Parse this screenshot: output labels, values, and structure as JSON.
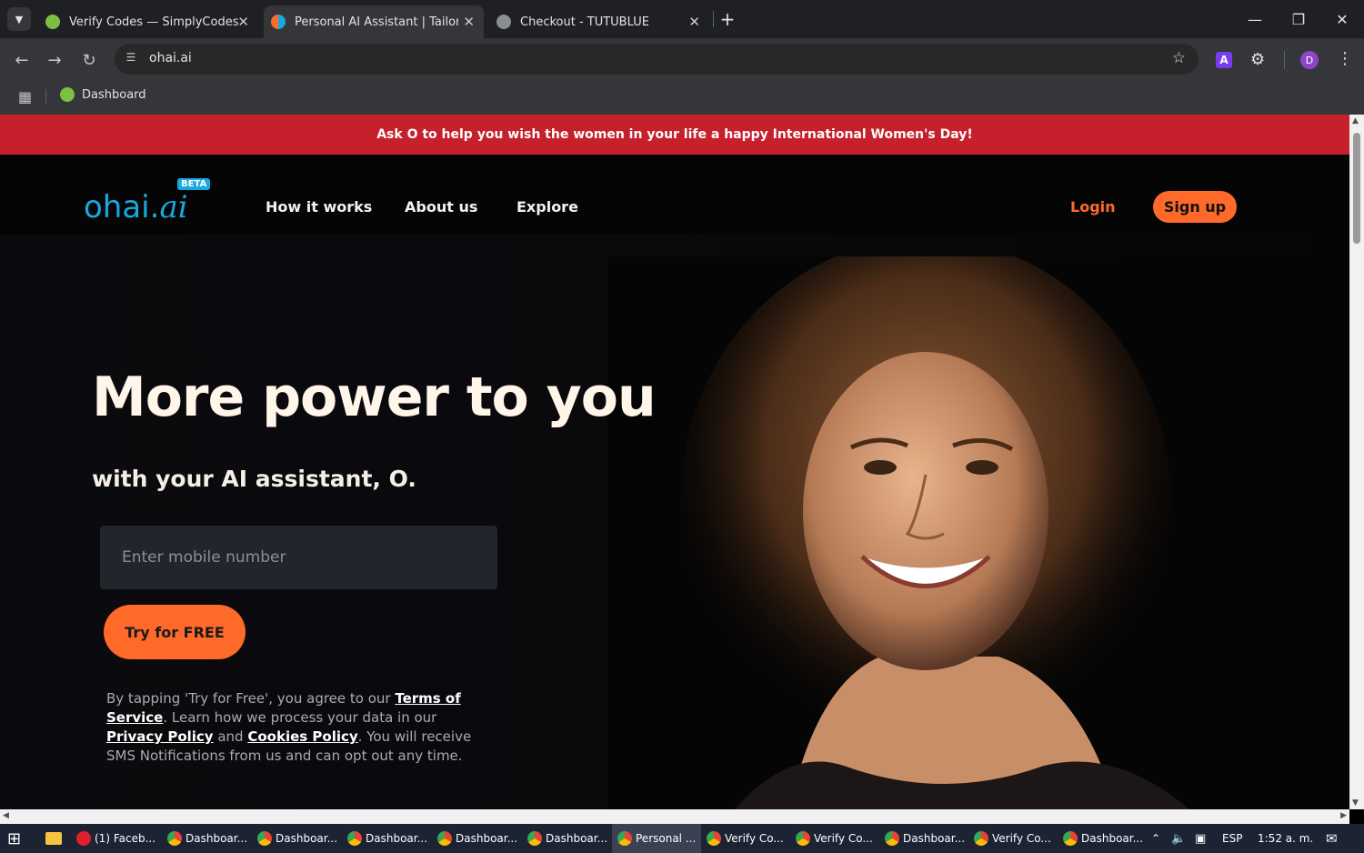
{
  "browser": {
    "tabs": [
      {
        "title": "Verify Codes — SimplyCodes",
        "active": false
      },
      {
        "title": "Personal AI Assistant | Tailored f",
        "active": true
      },
      {
        "title": "Checkout - TUTUBLUE",
        "active": false
      }
    ],
    "new_tab_label": "+",
    "url": "ohai.ai",
    "profile_initial": "D",
    "extension_letter": "A",
    "bookmarks": [
      {
        "label": "Dashboard"
      }
    ]
  },
  "page": {
    "banner_text": "Ask O to help you wish the women in your life a happy International Women's Day!",
    "logo_text": "ohai.",
    "logo_ai": "ai",
    "logo_badge": "BETA",
    "nav": [
      "How it works",
      "About us",
      "Explore"
    ],
    "login_label": "Login",
    "signup_label": "Sign up",
    "headline": "More power to you",
    "subheadline": "with your AI assistant, O.",
    "phone_placeholder": "Enter mobile number",
    "cta_label": "Try for FREE",
    "legal": {
      "t1": "By tapping 'Try for Free', you agree to our ",
      "terms": "Terms of Service",
      "t2": ". Learn how we process your data in our ",
      "privacy": "Privacy Policy",
      "t3": " and ",
      "cookies": "Cookies Policy",
      "t4": ". You will receive SMS Notifications from us and can opt out any time."
    },
    "colors": {
      "banner": "#c5202b",
      "accent": "#ff6a2a",
      "logo": "#1aa8e0"
    }
  },
  "taskbar": {
    "items": [
      {
        "label": "(1) Faceb...",
        "icon": "opera-icon"
      },
      {
        "label": "Dashboar...",
        "icon": "chrome-icon"
      },
      {
        "label": "Dashboar...",
        "icon": "chrome-icon"
      },
      {
        "label": "Dashboar...",
        "icon": "chrome-icon"
      },
      {
        "label": "Dashboar...",
        "icon": "chrome-icon"
      },
      {
        "label": "Dashboar...",
        "icon": "chrome-icon"
      },
      {
        "label": "Personal ...",
        "icon": "chrome-icon",
        "active": true
      },
      {
        "label": "Verify Co...",
        "icon": "chrome-icon"
      },
      {
        "label": "Verify Co...",
        "icon": "chrome-icon"
      },
      {
        "label": "Dashboar...",
        "icon": "chrome-icon"
      },
      {
        "label": "Verify Co...",
        "icon": "chrome-icon"
      },
      {
        "label": "Dashboar...",
        "icon": "chrome-icon"
      }
    ],
    "language": "ESP",
    "time": "1:52 a. m."
  }
}
